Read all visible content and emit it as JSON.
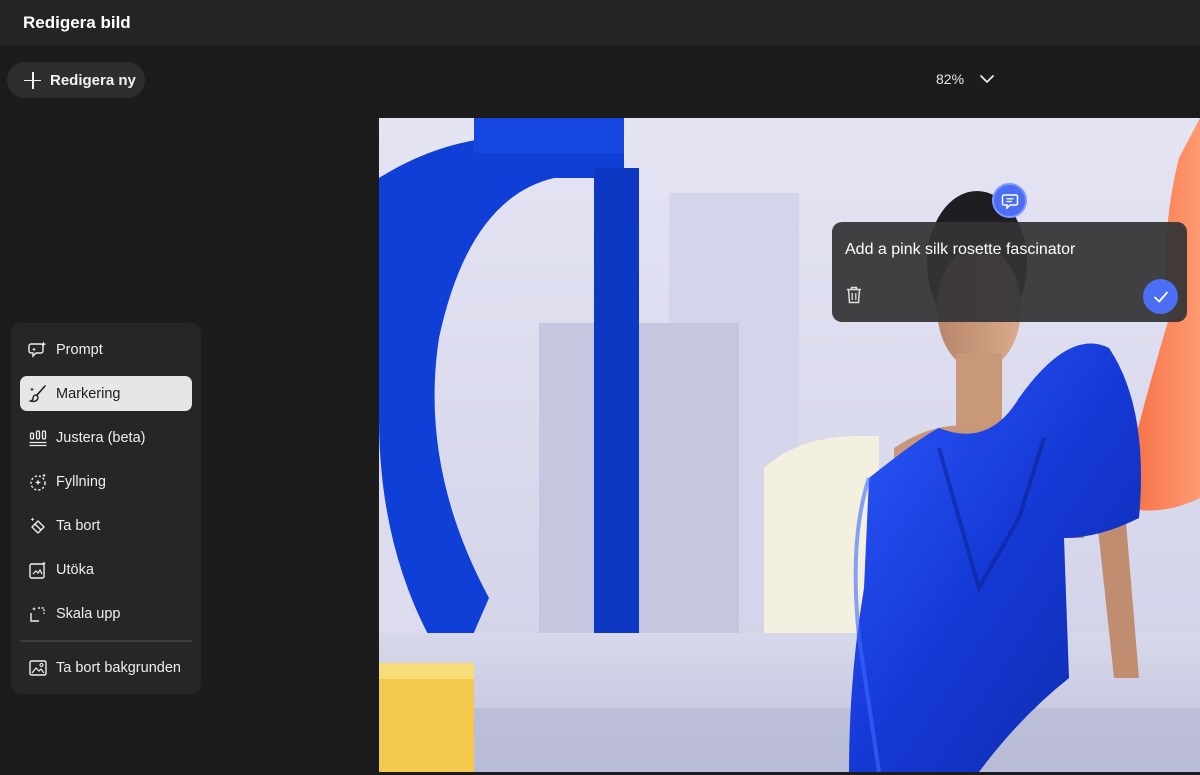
{
  "header": {
    "title": "Redigera bild"
  },
  "new_edit": {
    "label": "Redigera ny",
    "icon": "plus-icon"
  },
  "zoom": {
    "value": "82%",
    "icon": "chevron-down-icon"
  },
  "tools": [
    {
      "label": "Prompt",
      "icon": "prompt-sparkle-icon",
      "active": false
    },
    {
      "label": "Markering",
      "icon": "brush-icon",
      "active": true
    },
    {
      "label": "Justera (beta)",
      "icon": "sliders-icon",
      "active": false
    },
    {
      "label": "Fyllning",
      "icon": "fill-icon",
      "active": false
    },
    {
      "label": "Ta bort",
      "icon": "eraser-icon",
      "active": false
    },
    {
      "label": "Utöka",
      "icon": "expand-icon",
      "active": false
    },
    {
      "label": "Skala upp",
      "icon": "upscale-icon",
      "active": false
    },
    {
      "label": "Ta bort bakgrunden",
      "icon": "remove-background-icon",
      "active": false
    }
  ],
  "prompt_popup": {
    "text": "Add a pink silk rosette fascinator",
    "delete_icon": "trash-icon",
    "confirm_icon": "checkmark-icon",
    "pin_icon": "comment-icon"
  },
  "colors": {
    "accent": "#4b6ef5",
    "background": "#1c1c1c",
    "panel": "#262626",
    "active_tool": "#e6e6e6"
  }
}
